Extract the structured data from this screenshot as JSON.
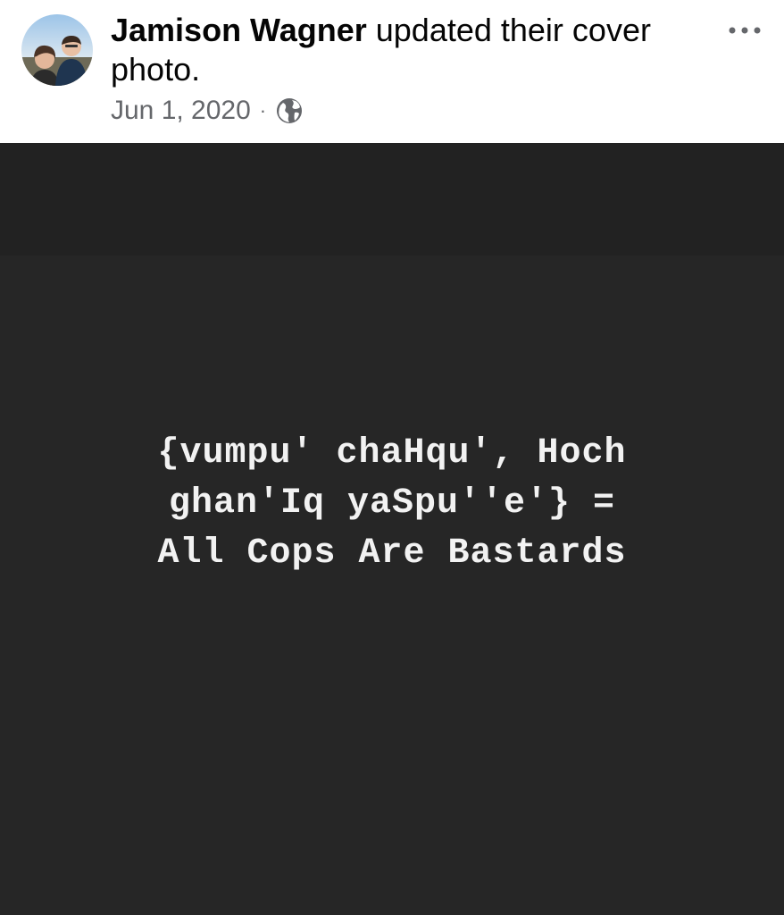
{
  "post": {
    "author_name": "Jamison Wagner",
    "action_text": "updated their cover photo.",
    "date": "Jun 1, 2020",
    "separator": "·",
    "privacy_icon": "globe-icon",
    "more_icon": "more-options-icon",
    "avatar_icon": "profile-avatar"
  },
  "cover_photo": {
    "lines": [
      "{vumpu' chaHqu', Hoch",
      "ghan'Iq yaSpu''e'} =",
      "All Cops Are Bastards"
    ]
  },
  "colors": {
    "name_text": "#050505",
    "meta_text": "#65676b",
    "photo_background": "#262626",
    "photo_text": "#f2f2f2"
  }
}
